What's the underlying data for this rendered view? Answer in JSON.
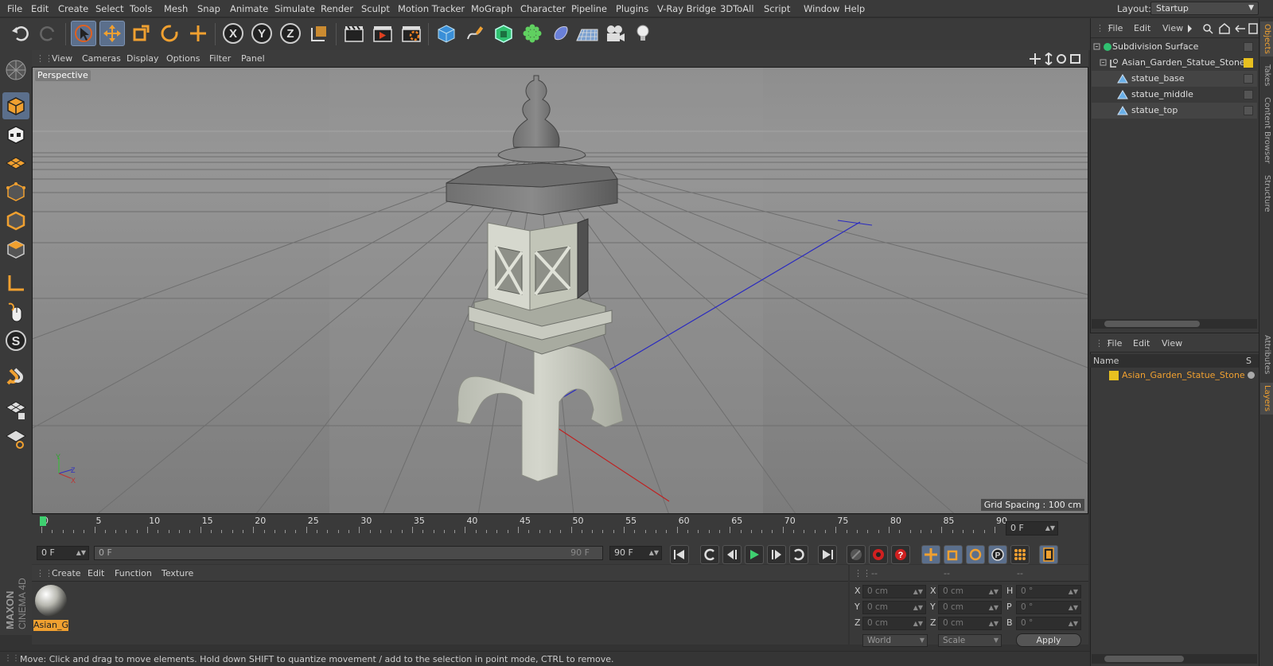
{
  "menubar": {
    "items": [
      "File",
      "Edit",
      "Create",
      "Select",
      "Tools",
      "Mesh",
      "Snap",
      "Animate",
      "Simulate",
      "Render",
      "Sculpt",
      "Motion Tracker",
      "MoGraph",
      "Character",
      "Pipeline",
      "Plugins",
      "V-Ray Bridge",
      "3DToAll",
      "Script",
      "Window",
      "Help"
    ],
    "layout_label": "Layout:",
    "layout_value": "Startup"
  },
  "toolbar": {
    "axis_x": "X",
    "axis_y": "Y",
    "axis_z": "Z"
  },
  "left_tools": {
    "snap_letter": "S"
  },
  "viewport": {
    "menu": [
      "View",
      "Cameras",
      "Display",
      "Options",
      "Filter",
      "Panel"
    ],
    "label": "Perspective",
    "grid_spacing": "Grid Spacing : 100 cm",
    "axis_y": "Y",
    "axis_z": "Z",
    "axis_x": "X"
  },
  "timeline": {
    "ticks": [
      "0",
      "5",
      "10",
      "15",
      "20",
      "25",
      "30",
      "35",
      "40",
      "45",
      "50",
      "55",
      "60",
      "65",
      "70",
      "75",
      "80",
      "85",
      "90"
    ],
    "current_frame": "0 F"
  },
  "transport": {
    "start_field": "0 F",
    "range_start": "0 F",
    "range_end": "90 F",
    "end_field": "90 F"
  },
  "materials": {
    "menu": [
      "Create",
      "Edit",
      "Function",
      "Texture"
    ],
    "material_name": "Asian_G"
  },
  "coordinates": {
    "header_1": "--",
    "header_2": "--",
    "header_3": "--",
    "rows": [
      {
        "l1": "X",
        "v1": "0 cm",
        "l2": "X",
        "v2": "0 cm",
        "l3": "H",
        "v3": "0 °"
      },
      {
        "l1": "Y",
        "v1": "0 cm",
        "l2": "Y",
        "v2": "0 cm",
        "l3": "P",
        "v3": "0 °"
      },
      {
        "l1": "Z",
        "v1": "0 cm",
        "l2": "Z",
        "v2": "0 cm",
        "l3": "B",
        "v3": "0 °"
      }
    ],
    "mode1": "World",
    "mode2": "Scale",
    "apply": "Apply"
  },
  "status": {
    "text": "Move: Click and drag to move elements. Hold down SHIFT to quantize movement / add to the selection in point mode, CTRL to remove."
  },
  "objects": {
    "menu": [
      "File",
      "Edit",
      "View"
    ],
    "items": [
      {
        "name": "Subdivision Surface"
      },
      {
        "name": "Asian_Garden_Statue_Stone"
      },
      {
        "name": "statue_base"
      },
      {
        "name": "statue_middle"
      },
      {
        "name": "statue_top"
      }
    ]
  },
  "layers": {
    "menu": [
      "File",
      "Edit",
      "View"
    ],
    "col_name": "Name",
    "col_s": "S",
    "items": [
      {
        "name": "Asian_Garden_Statue_Stone"
      }
    ]
  },
  "right_tabs": {
    "objects": "Objects",
    "takes": "Takes",
    "content_browser": "Content Browser",
    "structure": "Structure",
    "attributes": "Attributes",
    "layers": "Layers"
  },
  "brand": {
    "maxon": "MAXON",
    "cinema": "CINEMA 4D"
  },
  "colors": {
    "accent_orange": "#f0a030",
    "selection_blue": "#5b6f8c",
    "layer_yellow": "#e8c020",
    "timeline_green": "#3fd070"
  }
}
